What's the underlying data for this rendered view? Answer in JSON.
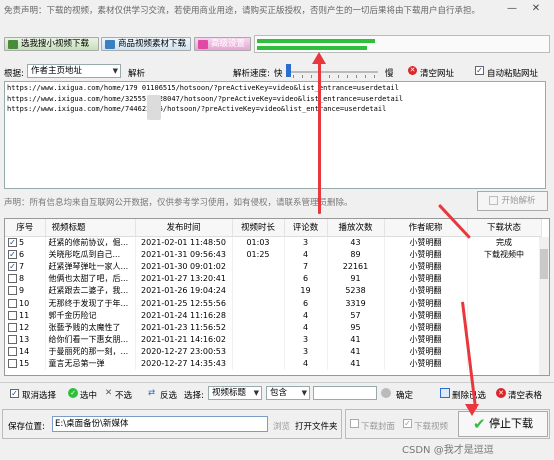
{
  "window": {
    "disclaimer": "免责声明：下载的视频，素材仅供学习交流，若使用商业用途，请购买正版授权，否则产生的一切后果将由下载用户自行承担。"
  },
  "toolbar": {
    "buttons": [
      "选我搜小视频下载",
      "商品视频素材下载",
      "高级设置"
    ]
  },
  "options": {
    "root_label": "根据:",
    "root_value": "作者主页地址",
    "parse_label": "解析",
    "speed_label": "解析速度:",
    "speed_fast": "快",
    "speed_slow": "慢",
    "clear_url": "清空网址",
    "auto_paste": "自动粘贴网址"
  },
  "urls": [
    "https://www.ixigua.com/home/179  01106515/hotsoon/?preActiveKey=video&list_entrance=userdetail",
    "https://www.ixigua.com/home/32555  7628047/hotsoon/?preActiveKey=video&list_entrance=userdetail",
    "https://www.ixigua.com/home/744623  85/hotsoon/?preActiveKey=video&list_entrance=userdetail"
  ],
  "notice": {
    "text": "声明：所有信息均来自互联网公开数据，仅供参考学习使用，如有侵权，请联系管理员删除。",
    "start_parse": "开始解析"
  },
  "table": {
    "headers": [
      "序号",
      "视频标题",
      "发布时间",
      "视频时长",
      "评论数",
      "播放次数",
      "作者昵称",
      "下载状态"
    ],
    "rows": [
      [
        "5",
        "赶紧的修前协议，倔...",
        "2021-02-01 11:48:50",
        "01:03",
        "3",
        "43",
        "小赞明翻",
        "完成"
      ],
      [
        "6",
        "关晓彤吃瓜到自己...",
        "2021-01-31 09:56:43",
        "01:25",
        "4",
        "89",
        "小赞明翻",
        "下载视频中"
      ],
      [
        "7",
        "赶紧弹琴弹吐一家人...",
        "2021-01-30 09:01:02",
        "",
        "7",
        "22161",
        "小赞明翻",
        ""
      ],
      [
        "8",
        "他俩也太甜了吧，后...",
        "2021-01-27 13:20:41",
        "",
        "6",
        "91",
        "小赞明翻",
        ""
      ],
      [
        "9",
        "赶紧跟去二婆子，我...",
        "2021-01-26 19:04:24",
        "",
        "19",
        "5238",
        "小赞明翻",
        ""
      ],
      [
        "10",
        "无那终于发现了于年...",
        "2021-01-25 12:55:56",
        "",
        "6",
        "3319",
        "小赞明翻",
        ""
      ],
      [
        "11",
        "郭千金历险记",
        "2021-01-24 11:16:28",
        "",
        "4",
        "57",
        "小赞明翻",
        ""
      ],
      [
        "12",
        "张藝予贱的太魔性了",
        "2021-01-23 11:56:52",
        "",
        "4",
        "95",
        "小赞明翻",
        ""
      ],
      [
        "13",
        "给你们看一下惠女朋...",
        "2021-01-21 14:16:02",
        "",
        "3",
        "41",
        "小赞明翻",
        ""
      ],
      [
        "14",
        "于曼丽死的那一刻，...",
        "2020-12-27 23:00:53",
        "",
        "3",
        "41",
        "小赞明翻",
        ""
      ],
      [
        "15",
        "童言无忌第一弹",
        "2020-12-27 14:35:43",
        "",
        "4",
        "41",
        "小赞明翻",
        ""
      ]
    ],
    "checked": [
      true,
      true,
      true,
      false,
      false,
      false,
      false,
      false,
      false,
      false,
      false
    ]
  },
  "filters": {
    "cancel_select": "取消选择",
    "select": "选中",
    "unselect": "不选",
    "invert": "反选",
    "select_label": "选择:",
    "field": "视频标题",
    "op": "包含",
    "confirm": "确定",
    "delete_selected": "删除已选",
    "clear_table": "清空表格"
  },
  "save": {
    "label": "保存位置:",
    "path": "E:\\桌面备份\\新媒体",
    "browse": "浏览",
    "open_folder": "打开文件夹",
    "dl_cover": "下载封面",
    "dl_video": "下载视频",
    "stop": "停止下载"
  },
  "watermark": "CSDN @我才是逗逗",
  "colors": {
    "accent_green": "#2fbf3a",
    "arrow_red": "#e8383d",
    "clear_red": "#d9262b"
  }
}
